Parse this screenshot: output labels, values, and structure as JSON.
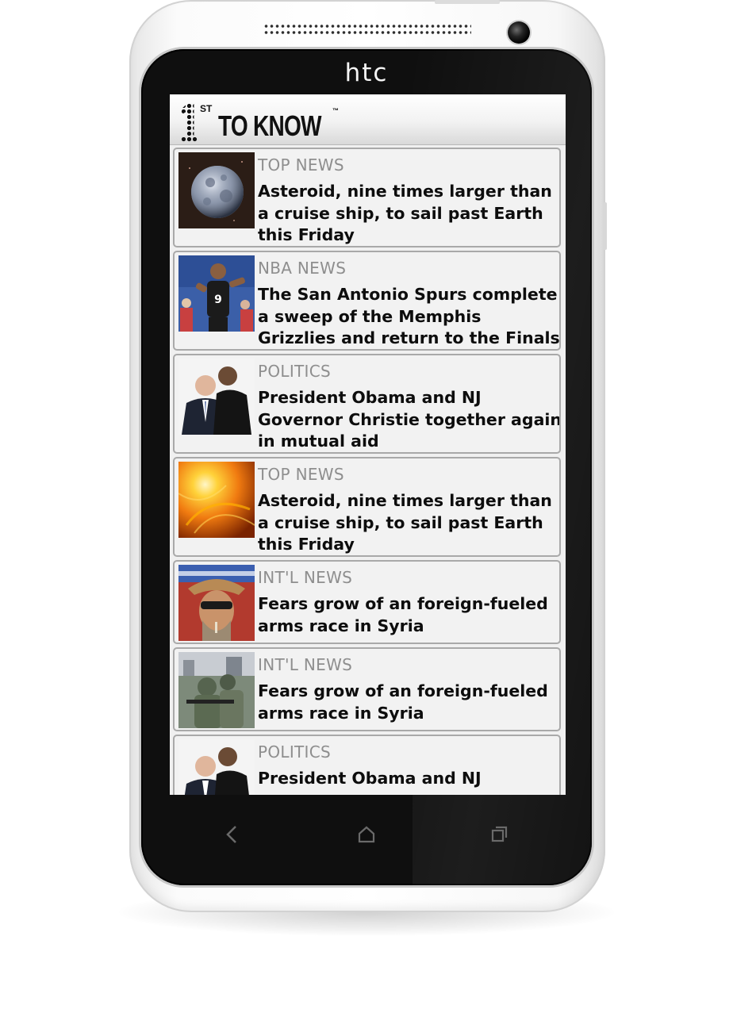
{
  "device": {
    "brand": "htc"
  },
  "app": {
    "logo_number": "1",
    "logo_suffix": "ST",
    "logo_text": "TO KNOW",
    "logo_tm": "™"
  },
  "articles": [
    {
      "category": "TOP NEWS",
      "headline": "Asteroid, nine times larger than\na cruise ship, to sail past Earth\nthis Friday",
      "thumb": "asteroid-image"
    },
    {
      "category": "NBA NEWS",
      "headline": "The San Antonio Spurs complete\na sweep of the Memphis\nGrizzlies and return to the Finals",
      "thumb": "basketball-player-image"
    },
    {
      "category": "POLITICS",
      "headline": "President Obama and NJ\nGovernor Christie together again\nin mutual aid",
      "thumb": "politicians-image"
    },
    {
      "category": "TOP NEWS",
      "headline": "Asteroid, nine times larger than\na cruise ship, to sail past Earth\nthis Friday",
      "thumb": "solar-flare-image"
    },
    {
      "category": "INT'L NEWS",
      "headline": "Fears grow of an foreign-fueled\narms race in Syria",
      "thumb": "protester-image"
    },
    {
      "category": "INT'L NEWS",
      "headline": "Fears grow of an foreign-fueled\narms race in Syria",
      "thumb": "soldiers-image"
    },
    {
      "category": "POLITICS",
      "headline": "President Obama and NJ",
      "thumb": "politicians-image"
    }
  ],
  "nav": {
    "back": "back-icon",
    "home": "home-icon",
    "recent": "recent-apps-icon"
  }
}
